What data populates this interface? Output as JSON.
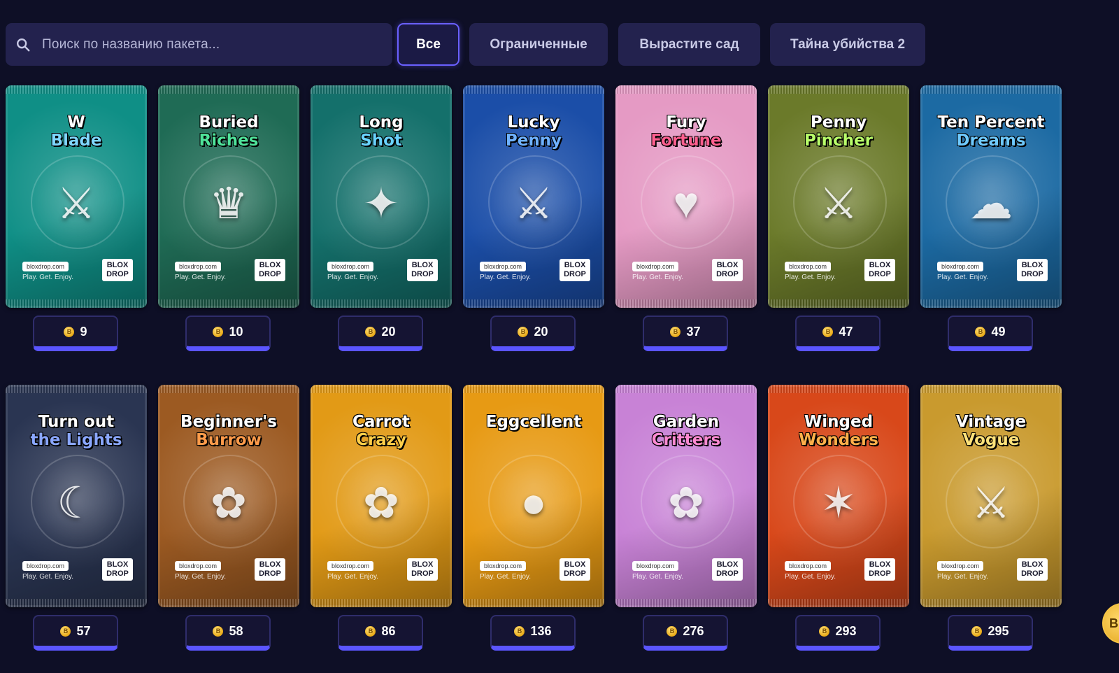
{
  "search": {
    "placeholder": "Поиск по названию пакета...",
    "icon": "search-icon"
  },
  "filters": [
    {
      "label": "Все",
      "active": true
    },
    {
      "label": "Ограниченные",
      "active": false
    },
    {
      "label": "Вырастите сад",
      "active": false
    },
    {
      "label": "Тайна убийства 2",
      "active": false
    }
  ],
  "pack_common": {
    "site": "bloxdrop.com",
    "slogan": "Play. Get. Enjoy.",
    "logo_line1": "BLOX",
    "logo_line2": "DROP"
  },
  "packs": [
    {
      "title1": "W",
      "title2": "Blade",
      "price": "9",
      "color": "#0f8f86",
      "accent": "#7fd7ff",
      "glyph": "⚔"
    },
    {
      "title1": "Buried",
      "title2": "Riches",
      "price": "10",
      "color": "#1f6b55",
      "accent": "#4fe39a",
      "glyph": "♛"
    },
    {
      "title1": "Long",
      "title2": "Shot",
      "price": "20",
      "color": "#14706b",
      "accent": "#6ad4ff",
      "glyph": "✦"
    },
    {
      "title1": "Lucky",
      "title2": "Penny",
      "price": "20",
      "color": "#1b4ea8",
      "accent": "#6fb2ff",
      "glyph": "⚔"
    },
    {
      "title1": "Fury",
      "title2": "Fortune",
      "price": "37",
      "color": "#e59ac4",
      "accent": "#ff5f8f",
      "glyph": "♥"
    },
    {
      "title1": "Penny",
      "title2": "Pincher",
      "price": "47",
      "color": "#6b7a2a",
      "accent": "#b9ff6a",
      "glyph": "⚔"
    },
    {
      "title1": "Ten Percent",
      "title2": "Dreams",
      "price": "49",
      "color": "#1c6aa3",
      "accent": "#6fcaff",
      "glyph": "☁"
    },
    {
      "title1": "Turn out",
      "title2": "the Lights",
      "price": "57",
      "color": "#2a3552",
      "accent": "#8aa7ff",
      "glyph": "☾"
    },
    {
      "title1": "Beginner's",
      "title2": "Burrow",
      "price": "58",
      "color": "#9c5a22",
      "accent": "#ff9b4a",
      "glyph": "✿"
    },
    {
      "title1": "Carrot",
      "title2": "Crazy",
      "price": "86",
      "color": "#e29a16",
      "accent": "#ffcf4a",
      "glyph": "✿"
    },
    {
      "title1": "Eggcellent",
      "title2": "",
      "price": "136",
      "color": "#e79a14",
      "accent": "#ffd24a",
      "glyph": "●"
    },
    {
      "title1": "Garden",
      "title2": "Critters",
      "price": "276",
      "color": "#c882d6",
      "accent": "#ff8ad2",
      "glyph": "✿"
    },
    {
      "title1": "Winged",
      "title2": "Wonders",
      "price": "293",
      "color": "#d8481a",
      "accent": "#ffb04a",
      "glyph": "✶"
    },
    {
      "title1": "Vintage",
      "title2": "Vogue",
      "price": "295",
      "color": "#c99a2e",
      "accent": "#ffe27a",
      "glyph": "⚔"
    }
  ],
  "side_button_label": "B"
}
